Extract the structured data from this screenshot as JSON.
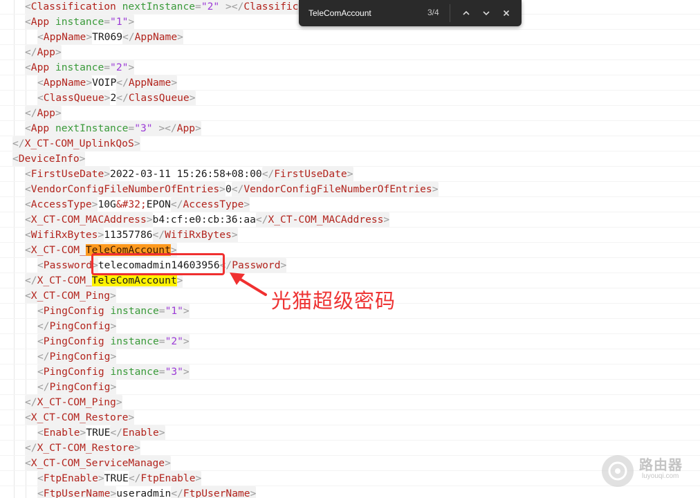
{
  "find": {
    "query": "TeleComAccount",
    "count": "3/4",
    "prev_icon": "chevron-up-icon",
    "next_icon": "chevron-down-icon",
    "close_icon": "close-icon"
  },
  "callout": "光猫超级密码",
  "watermark": {
    "name": "路由器",
    "url": "luyouqi.com"
  },
  "lines": [
    {
      "indent": 2,
      "parts": [
        [
          "br",
          "<"
        ],
        [
          "tn",
          "Classification"
        ],
        [
          "t",
          " "
        ],
        [
          "an",
          "nextInstance"
        ],
        [
          "br",
          "="
        ],
        [
          "av",
          "\"2\""
        ],
        [
          "t",
          " "
        ],
        [
          "br",
          "></"
        ],
        [
          "tn",
          "Classification"
        ],
        [
          "br",
          ">"
        ]
      ]
    },
    {
      "indent": 2,
      "parts": [
        [
          "br",
          "<"
        ],
        [
          "tn",
          "App"
        ],
        [
          "t",
          " "
        ],
        [
          "an",
          "instance"
        ],
        [
          "br",
          "="
        ],
        [
          "av",
          "\"1\""
        ],
        [
          "br",
          ">"
        ]
      ]
    },
    {
      "indent": 3,
      "parts": [
        [
          "br",
          "<"
        ],
        [
          "tn",
          "AppName"
        ],
        [
          "br",
          ">"
        ],
        [
          "t",
          "TR069"
        ],
        [
          "br",
          "</"
        ],
        [
          "tn",
          "AppName"
        ],
        [
          "br",
          ">"
        ]
      ]
    },
    {
      "indent": 2,
      "parts": [
        [
          "br",
          "</"
        ],
        [
          "tn",
          "App"
        ],
        [
          "br",
          ">"
        ]
      ]
    },
    {
      "indent": 2,
      "parts": [
        [
          "br",
          "<"
        ],
        [
          "tn",
          "App"
        ],
        [
          "t",
          " "
        ],
        [
          "an",
          "instance"
        ],
        [
          "br",
          "="
        ],
        [
          "av",
          "\"2\""
        ],
        [
          "br",
          ">"
        ]
      ]
    },
    {
      "indent": 3,
      "parts": [
        [
          "br",
          "<"
        ],
        [
          "tn",
          "AppName"
        ],
        [
          "br",
          ">"
        ],
        [
          "t",
          "VOIP"
        ],
        [
          "br",
          "</"
        ],
        [
          "tn",
          "AppName"
        ],
        [
          "br",
          ">"
        ]
      ]
    },
    {
      "indent": 3,
      "parts": [
        [
          "br",
          "<"
        ],
        [
          "tn",
          "ClassQueue"
        ],
        [
          "br",
          ">"
        ],
        [
          "t",
          "2"
        ],
        [
          "br",
          "</"
        ],
        [
          "tn",
          "ClassQueue"
        ],
        [
          "br",
          ">"
        ]
      ]
    },
    {
      "indent": 2,
      "parts": [
        [
          "br",
          "</"
        ],
        [
          "tn",
          "App"
        ],
        [
          "br",
          ">"
        ]
      ]
    },
    {
      "indent": 2,
      "parts": [
        [
          "br",
          "<"
        ],
        [
          "tn",
          "App"
        ],
        [
          "t",
          " "
        ],
        [
          "an",
          "nextInstance"
        ],
        [
          "br",
          "="
        ],
        [
          "av",
          "\"3\""
        ],
        [
          "t",
          " "
        ],
        [
          "br",
          "></"
        ],
        [
          "tn",
          "App"
        ],
        [
          "br",
          ">"
        ]
      ]
    },
    {
      "indent": 1,
      "parts": [
        [
          "br",
          "</"
        ],
        [
          "tn",
          "X_CT-COM_UplinkQoS"
        ],
        [
          "br",
          ">"
        ]
      ]
    },
    {
      "indent": 1,
      "parts": [
        [
          "br",
          "<"
        ],
        [
          "tn",
          "DeviceInfo"
        ],
        [
          "br",
          ">"
        ]
      ]
    },
    {
      "indent": 2,
      "parts": [
        [
          "br",
          "<"
        ],
        [
          "tn",
          "FirstUseDate"
        ],
        [
          "br",
          ">"
        ],
        [
          "t",
          "2022-03-11 15:26:58+08:00"
        ],
        [
          "br",
          "</"
        ],
        [
          "tn",
          "FirstUseDate"
        ],
        [
          "br",
          ">"
        ]
      ]
    },
    {
      "indent": 2,
      "parts": [
        [
          "br",
          "<"
        ],
        [
          "tn",
          "VendorConfigFileNumberOfEntries"
        ],
        [
          "br",
          ">"
        ],
        [
          "t",
          "0"
        ],
        [
          "br",
          "</"
        ],
        [
          "tn",
          "VendorConfigFileNumberOfEntries"
        ],
        [
          "br",
          ">"
        ]
      ]
    },
    {
      "indent": 2,
      "parts": [
        [
          "br",
          "<"
        ],
        [
          "tn",
          "AccessType"
        ],
        [
          "br",
          ">"
        ],
        [
          "t",
          "10G"
        ],
        [
          "tn",
          "&#32;"
        ],
        [
          "t",
          "EPON"
        ],
        [
          "br",
          "</"
        ],
        [
          "tn",
          "AccessType"
        ],
        [
          "br",
          ">"
        ]
      ]
    },
    {
      "indent": 2,
      "parts": [
        [
          "br",
          "<"
        ],
        [
          "tn",
          "X_CT-COM_MACAddress"
        ],
        [
          "br",
          ">"
        ],
        [
          "t",
          "b4:cf:e0:cb:36:aa"
        ],
        [
          "br",
          "</"
        ],
        [
          "tn",
          "X_CT-COM_MACAddress"
        ],
        [
          "br",
          ">"
        ]
      ]
    },
    {
      "indent": 2,
      "parts": [
        [
          "br",
          "<"
        ],
        [
          "tn",
          "WifiRxBytes"
        ],
        [
          "br",
          ">"
        ],
        [
          "t",
          "11357786"
        ],
        [
          "br",
          "</"
        ],
        [
          "tn",
          "WifiRxBytes"
        ],
        [
          "br",
          ">"
        ]
      ]
    },
    {
      "indent": 2,
      "parts": [
        [
          "br",
          "<"
        ],
        [
          "tn",
          "X_CT-COM_"
        ],
        [
          "ho",
          "TeleComAccount"
        ],
        [
          "br",
          ">"
        ]
      ]
    },
    {
      "indent": 3,
      "parts": [
        [
          "br",
          "<"
        ],
        [
          "tn",
          "Password"
        ],
        [
          "br",
          ">"
        ],
        [
          "t",
          "telecomadmin14603956"
        ],
        [
          "br",
          "</"
        ],
        [
          "tn",
          "Password"
        ],
        [
          "br",
          ">"
        ]
      ]
    },
    {
      "indent": 2,
      "parts": [
        [
          "br",
          "</"
        ],
        [
          "tn",
          "X_CT-COM_"
        ],
        [
          "hy",
          "TeleComAccount"
        ],
        [
          "br",
          ">"
        ]
      ]
    },
    {
      "indent": 2,
      "parts": [
        [
          "br",
          "<"
        ],
        [
          "tn",
          "X_CT-COM_Ping"
        ],
        [
          "br",
          ">"
        ]
      ]
    },
    {
      "indent": 3,
      "parts": [
        [
          "br",
          "<"
        ],
        [
          "tn",
          "PingConfig"
        ],
        [
          "t",
          " "
        ],
        [
          "an",
          "instance"
        ],
        [
          "br",
          "="
        ],
        [
          "av",
          "\"1\""
        ],
        [
          "br",
          ">"
        ]
      ]
    },
    {
      "indent": 3,
      "parts": [
        [
          "br",
          "</"
        ],
        [
          "tn",
          "PingConfig"
        ],
        [
          "br",
          ">"
        ]
      ]
    },
    {
      "indent": 3,
      "parts": [
        [
          "br",
          "<"
        ],
        [
          "tn",
          "PingConfig"
        ],
        [
          "t",
          " "
        ],
        [
          "an",
          "instance"
        ],
        [
          "br",
          "="
        ],
        [
          "av",
          "\"2\""
        ],
        [
          "br",
          ">"
        ]
      ]
    },
    {
      "indent": 3,
      "parts": [
        [
          "br",
          "</"
        ],
        [
          "tn",
          "PingConfig"
        ],
        [
          "br",
          ">"
        ]
      ]
    },
    {
      "indent": 3,
      "parts": [
        [
          "br",
          "<"
        ],
        [
          "tn",
          "PingConfig"
        ],
        [
          "t",
          " "
        ],
        [
          "an",
          "instance"
        ],
        [
          "br",
          "="
        ],
        [
          "av",
          "\"3\""
        ],
        [
          "br",
          ">"
        ]
      ]
    },
    {
      "indent": 3,
      "parts": [
        [
          "br",
          "</"
        ],
        [
          "tn",
          "PingConfig"
        ],
        [
          "br",
          ">"
        ]
      ]
    },
    {
      "indent": 2,
      "parts": [
        [
          "br",
          "</"
        ],
        [
          "tn",
          "X_CT-COM_Ping"
        ],
        [
          "br",
          ">"
        ]
      ]
    },
    {
      "indent": 2,
      "parts": [
        [
          "br",
          "<"
        ],
        [
          "tn",
          "X_CT-COM_Restore"
        ],
        [
          "br",
          ">"
        ]
      ]
    },
    {
      "indent": 3,
      "parts": [
        [
          "br",
          "<"
        ],
        [
          "tn",
          "Enable"
        ],
        [
          "br",
          ">"
        ],
        [
          "t",
          "TRUE"
        ],
        [
          "br",
          "</"
        ],
        [
          "tn",
          "Enable"
        ],
        [
          "br",
          ">"
        ]
      ]
    },
    {
      "indent": 2,
      "parts": [
        [
          "br",
          "</"
        ],
        [
          "tn",
          "X_CT-COM_Restore"
        ],
        [
          "br",
          ">"
        ]
      ]
    },
    {
      "indent": 2,
      "parts": [
        [
          "br",
          "<"
        ],
        [
          "tn",
          "X_CT-COM_ServiceManage"
        ],
        [
          "br",
          ">"
        ]
      ]
    },
    {
      "indent": 3,
      "parts": [
        [
          "br",
          "<"
        ],
        [
          "tn",
          "FtpEnable"
        ],
        [
          "br",
          ">"
        ],
        [
          "t",
          "TRUE"
        ],
        [
          "br",
          "</"
        ],
        [
          "tn",
          "FtpEnable"
        ],
        [
          "br",
          ">"
        ]
      ]
    },
    {
      "indent": 3,
      "parts": [
        [
          "br",
          "<"
        ],
        [
          "tn",
          "FtpUserName"
        ],
        [
          "br",
          ">"
        ],
        [
          "t",
          "useradmin"
        ],
        [
          "br",
          "</"
        ],
        [
          "tn",
          "FtpUserName"
        ],
        [
          "br",
          ">"
        ]
      ]
    }
  ]
}
